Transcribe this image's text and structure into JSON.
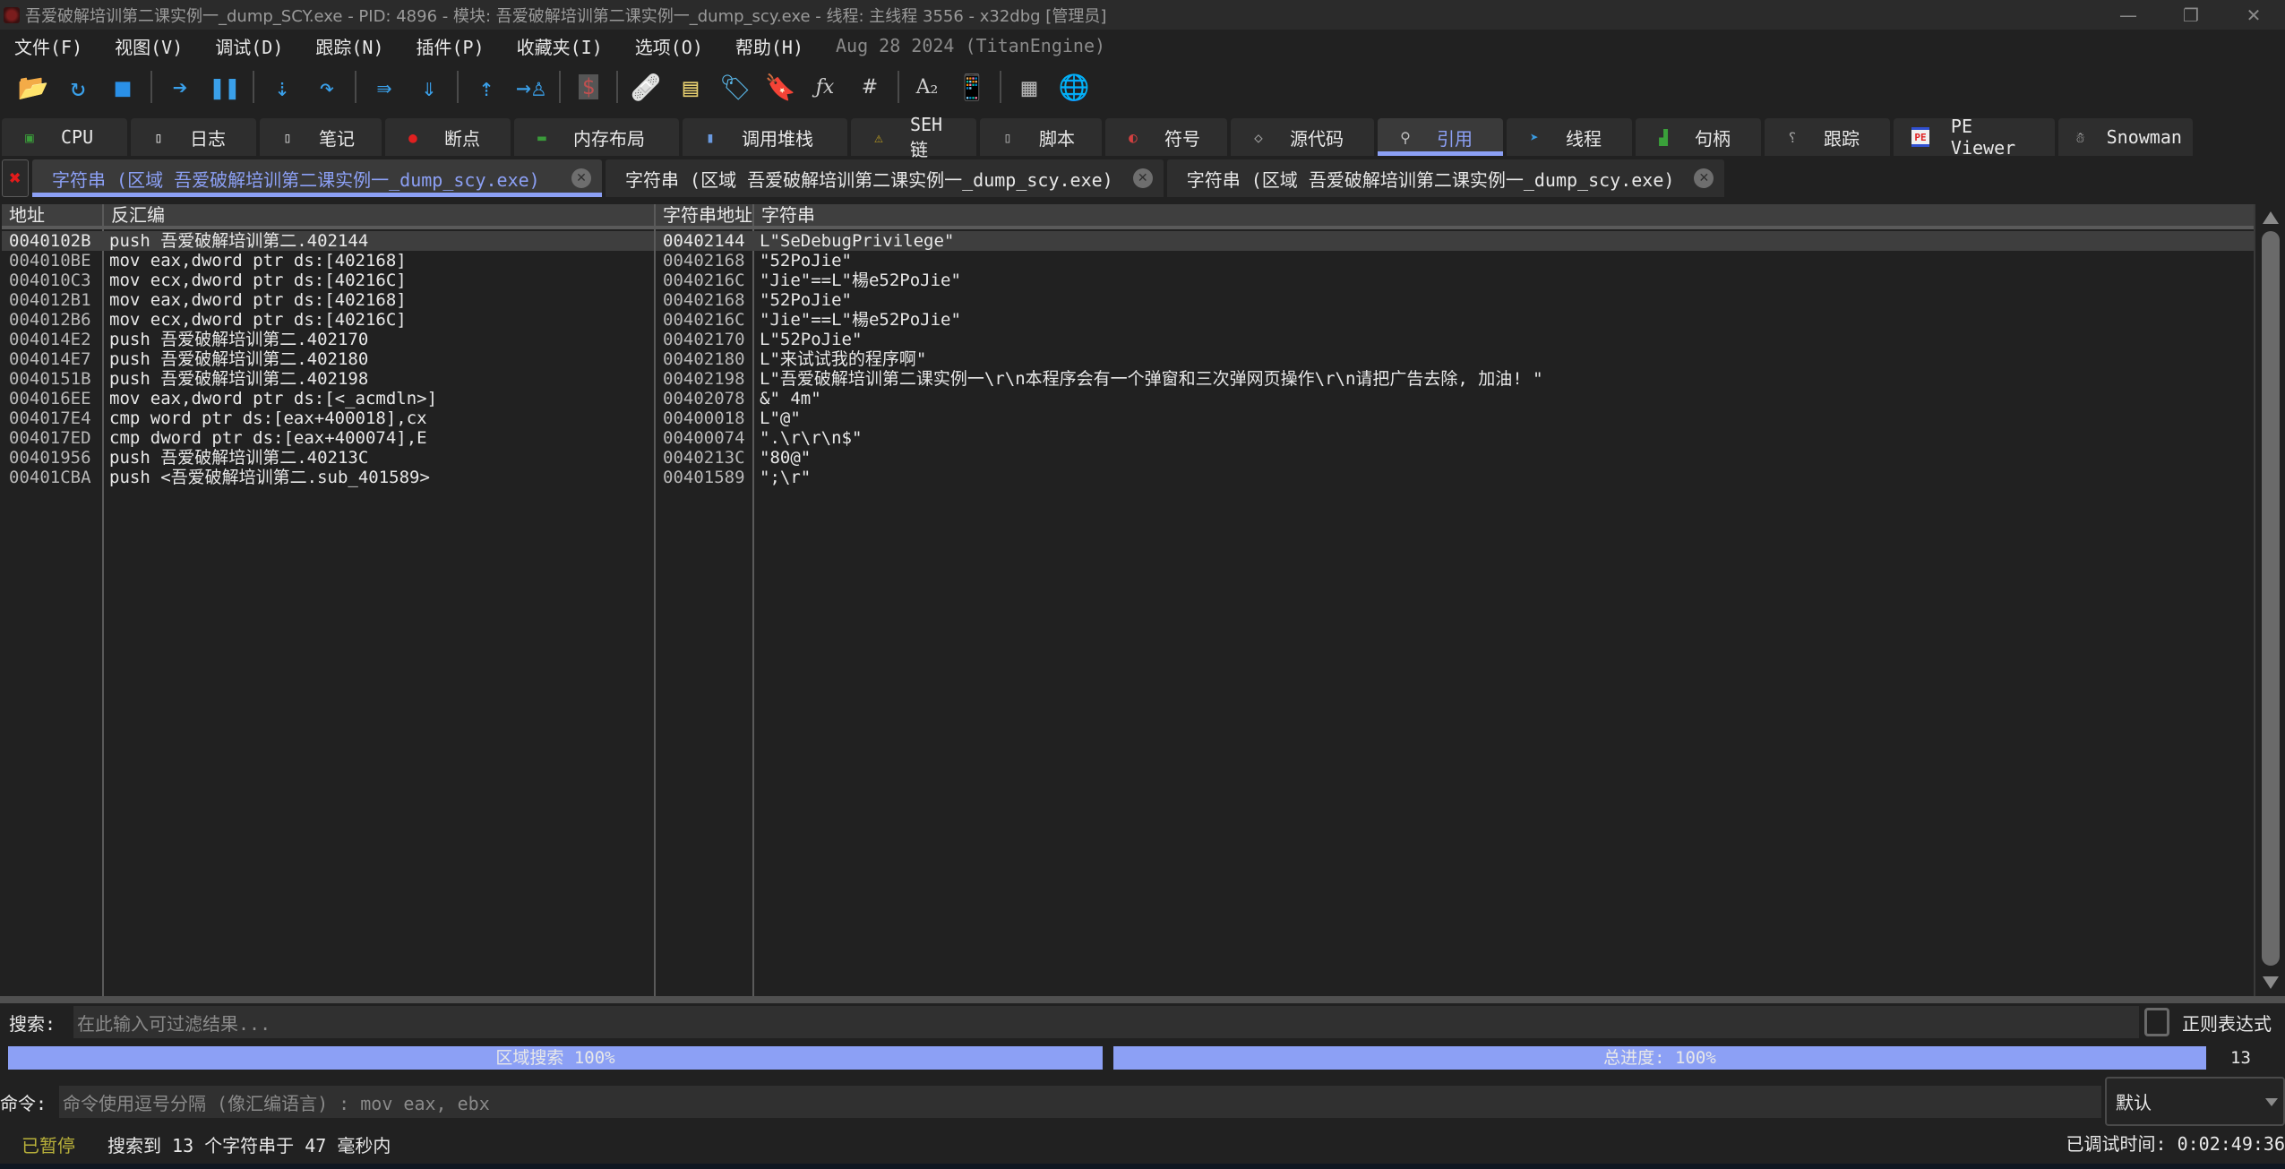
{
  "window": {
    "title": "吾爱破解培训第二课实例一_dump_SCY.exe - PID: 4896 - 模块: 吾爱破解培训第二课实例一_dump_scy.exe - 线程: 主线程 3556 - x32dbg [管理员]",
    "controls": {
      "minimize": "—",
      "restore": "❐",
      "close": "✕"
    }
  },
  "menu": {
    "items": [
      "文件(F)",
      "视图(V)",
      "调试(D)",
      "跟踪(N)",
      "插件(P)",
      "收藏夹(I)",
      "选项(O)",
      "帮助(H)"
    ],
    "version": "Aug 28 2024 (TitanEngine)"
  },
  "toolbar": {
    "buttons": [
      {
        "name": "open",
        "glyph": "📂",
        "color": "#e8c870"
      },
      {
        "name": "restart",
        "glyph": "↻",
        "color": "#3aa0ea"
      },
      {
        "name": "stop",
        "glyph": "■",
        "color": "#2a90e8"
      },
      {
        "sep": true
      },
      {
        "name": "run",
        "glyph": "➔",
        "color": "#3aa0ea"
      },
      {
        "name": "pause",
        "glyph": "❚❚",
        "color": "#3aa0ea"
      },
      {
        "sep": true
      },
      {
        "name": "step-into",
        "glyph": "⇣",
        "color": "#3aa0ea"
      },
      {
        "name": "step-over",
        "glyph": "↷",
        "color": "#3aa0ea"
      },
      {
        "sep": true
      },
      {
        "name": "trace-into",
        "glyph": "⇛",
        "color": "#3aa0ea"
      },
      {
        "name": "trace-over",
        "glyph": "⇓",
        "color": "#3aa0ea"
      },
      {
        "sep": true
      },
      {
        "name": "execute-till-return",
        "glyph": "⇡",
        "color": "#3aa0ea"
      },
      {
        "name": "run-to-user-code",
        "glyph": "→♙",
        "color": "#3aa0ea"
      },
      {
        "sep": true
      },
      {
        "name": "scylla",
        "glyph": "$",
        "color": "#c05050"
      },
      {
        "sep": true
      },
      {
        "name": "patches",
        "glyph": "🩹",
        "color": "#f0a070"
      },
      {
        "name": "comments",
        "glyph": "▤",
        "color": "#e8d070"
      },
      {
        "name": "labels",
        "glyph": "🏷",
        "color": "#5ab8ea"
      },
      {
        "name": "bookmarks",
        "glyph": "🔖",
        "color": "#e03a3a"
      },
      {
        "name": "functions",
        "glyph": "ƒx",
        "color": "#d0d0d0"
      },
      {
        "name": "variables",
        "glyph": "#",
        "color": "#d0d0d0"
      },
      {
        "sep": true
      },
      {
        "name": "strings",
        "glyph": "A₂",
        "color": "#d0d0d0"
      },
      {
        "name": "calls",
        "glyph": "📱",
        "color": "#5ab8ea"
      },
      {
        "sep": true
      },
      {
        "name": "calculator",
        "glyph": "▦",
        "color": "#b0b0b0"
      },
      {
        "name": "web",
        "glyph": "🌐",
        "color": "#3aa0ea"
      }
    ]
  },
  "main_tabs": [
    {
      "label": "CPU",
      "icon": "cpu-icon",
      "glyph": "▣",
      "color": "#3a9a3a"
    },
    {
      "label": "日志",
      "icon": "log-icon",
      "glyph": "▯",
      "color": "#e8e8e8"
    },
    {
      "label": "笔记",
      "icon": "notes-icon",
      "glyph": "▯",
      "color": "#d8d8d8"
    },
    {
      "label": "断点",
      "icon": "breakpoint-icon",
      "glyph": "●",
      "color": "#e02020"
    },
    {
      "label": "内存布局",
      "icon": "memory-map-icon",
      "glyph": "▬",
      "color": "#3a9a3a"
    },
    {
      "label": "调用堆栈",
      "icon": "call-stack-icon",
      "glyph": "▮",
      "color": "#6a9ae0"
    },
    {
      "label": "SEH链",
      "icon": "seh-icon",
      "glyph": "⚠",
      "color": "#c0a020"
    },
    {
      "label": "脚本",
      "icon": "script-icon",
      "glyph": "▯",
      "color": "#b0b0b0"
    },
    {
      "label": "符号",
      "icon": "symbols-icon",
      "glyph": "◐",
      "color": "#d04040"
    },
    {
      "label": "源代码",
      "icon": "source-icon",
      "glyph": "◇",
      "color": "#a0a0a0"
    },
    {
      "label": "引用",
      "icon": "references-icon",
      "glyph": "⚲",
      "color": "#c0c0c0",
      "active": true
    },
    {
      "label": "线程",
      "icon": "threads-icon",
      "glyph": "➤",
      "color": "#3a9ae0"
    },
    {
      "label": "句柄",
      "icon": "handles-icon",
      "glyph": "▟",
      "color": "#3aa03a"
    },
    {
      "label": "跟踪",
      "icon": "trace-icon",
      "glyph": "⸮",
      "color": "#a0a0a0"
    },
    {
      "label": "PE Viewer",
      "icon": "pe-viewer-icon",
      "glyph": "PE",
      "color": "#e02020"
    },
    {
      "label": "Snowman",
      "icon": "snowman-icon",
      "glyph": "☃",
      "color": "#d0d0d0"
    }
  ],
  "sub_tabs": [
    {
      "label": "字符串 (区域 吾爱破解培训第二课实例一_dump_scy.exe)",
      "active": true
    },
    {
      "label": "字符串 (区域 吾爱破解培训第二课实例一_dump_scy.exe)"
    },
    {
      "label": "字符串 (区域 吾爱破解培训第二课实例一_dump_scy.exe)"
    }
  ],
  "left_table": {
    "columns": [
      "地址",
      "反汇编"
    ],
    "rows": [
      [
        "0040102B",
        "push 吾爱破解培训第二.402144"
      ],
      [
        "004010BE",
        "mov eax,dword ptr ds:[402168]"
      ],
      [
        "004010C3",
        "mov ecx,dword ptr ds:[40216C]"
      ],
      [
        "004012B1",
        "mov eax,dword ptr ds:[402168]"
      ],
      [
        "004012B6",
        "mov ecx,dword ptr ds:[40216C]"
      ],
      [
        "004014E2",
        "push 吾爱破解培训第二.402170"
      ],
      [
        "004014E7",
        "push 吾爱破解培训第二.402180"
      ],
      [
        "0040151B",
        "push 吾爱破解培训第二.402198"
      ],
      [
        "004016EE",
        "mov eax,dword ptr ds:[<_acmdln>]"
      ],
      [
        "004017E4",
        "cmp word ptr ds:[eax+400018],cx"
      ],
      [
        "004017ED",
        "cmp dword ptr ds:[eax+400074],E"
      ],
      [
        "00401956",
        "push 吾爱破解培训第二.40213C"
      ],
      [
        "00401CBA",
        "push <吾爱破解培训第二.sub_401589>"
      ]
    ]
  },
  "right_table": {
    "columns": [
      "字符串地址",
      "字符串"
    ],
    "rows": [
      [
        "00402144",
        "L\"SeDebugPrivilege\""
      ],
      [
        "00402168",
        "\"52PoJie\""
      ],
      [
        "0040216C",
        "\"Jie\"==L\"楊e52PoJie\""
      ],
      [
        "00402168",
        "\"52PoJie\""
      ],
      [
        "0040216C",
        "\"Jie\"==L\"楊e52PoJie\""
      ],
      [
        "00402170",
        "L\"52PoJie\""
      ],
      [
        "00402180",
        "L\"来试试我的程序啊\""
      ],
      [
        "00402198",
        "L\"吾爱破解培训第二课实例一\\r\\n本程序会有一个弹窗和三次弹网页操作\\r\\n请把广告去除, 加油! \""
      ],
      [
        "00402078",
        "&\" 4m\""
      ],
      [
        "00400018",
        "L\"@\""
      ],
      [
        "00400074",
        "\".\\r\\r\\n$\""
      ],
      [
        "0040213C",
        "\"80@\""
      ],
      [
        "00401589",
        "\";\\r\""
      ]
    ],
    "selected_row": 0
  },
  "search": {
    "label": "搜索:",
    "placeholder": "在此输入可过滤结果...",
    "value": "",
    "regex_label": "正则表达式",
    "regex_checked": false
  },
  "progress": {
    "region": {
      "label": "区域搜索 100%",
      "percent": 100
    },
    "total": {
      "label": "总进度: 100%",
      "percent": 100
    },
    "count": "13"
  },
  "command": {
    "label": "命令:",
    "placeholder": "命令使用逗号分隔 (像汇编语言) : mov eax, ebx",
    "value": "",
    "mode": "默认"
  },
  "status": {
    "state": "已暂停",
    "message": "搜索到 13 个字符串于 47 毫秒内",
    "debug_time": "已调试时间:  0:02:49:36"
  },
  "colors": {
    "accent": "#8ca0f5",
    "paused": "#b8b03a",
    "background": "#212121"
  }
}
